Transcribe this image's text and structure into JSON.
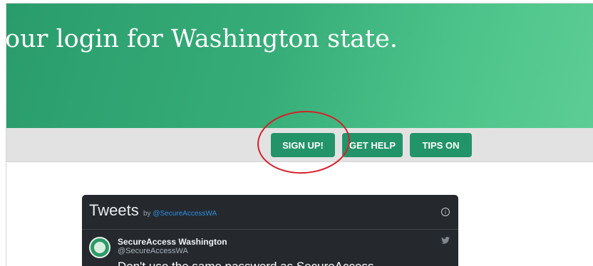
{
  "hero": {
    "title": "our login for Washington state."
  },
  "nav": {
    "signup": "SIGN UP!",
    "help": "GET HELP",
    "tips": "TIPS ON"
  },
  "tweets": {
    "title": "Tweets",
    "by_prefix": "by",
    "by_handle": "@SecureAccessWA",
    "info_icon": "i",
    "tweet": {
      "name": "SecureAccess Washington",
      "handle": "@SecureAccessWA",
      "text": "Don't use the same password as SecureAccess"
    }
  },
  "colors": {
    "brand_green": "#23946a",
    "annotation_red": "#d4202a",
    "twitter_dark": "#25292e"
  },
  "icons": [
    "info-icon",
    "twitter-bird-icon",
    "avatar-logo"
  ]
}
